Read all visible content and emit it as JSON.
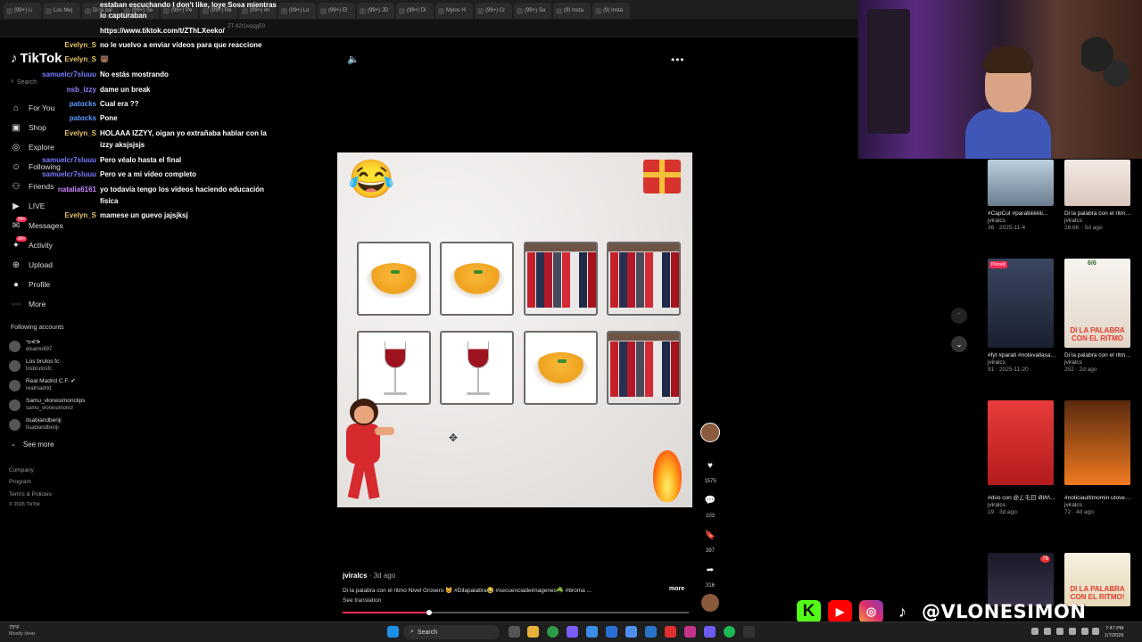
{
  "browser": {
    "tabs": [
      "(99+) Li",
      "Los Mej",
      "Di la pal",
      "(99+) Se",
      "(99+) Pe",
      "(99+) Re",
      "(99+) #n",
      "(99+) Lo",
      "(99+) El",
      "(99+) JD",
      "(99+) Di",
      "Mylos H",
      "(99+) Cr",
      "(99+) Sa",
      "(9) Insta",
      "(9) Insta"
    ],
    "url_fragment": "ZT-92t1wqqgE0"
  },
  "chat": [
    {
      "user": "",
      "user_color": "#ffffff",
      "message": "estaban escuchando I don't like, loye Sosa mientras"
    },
    {
      "user": "",
      "user_color": "#ffffff",
      "message": "lo capturaban"
    },
    {
      "user": "",
      "user_color": "#ffffff",
      "message": "https://www.tiktok.com/t/ZThLXeeko/"
    },
    {
      "user": "Evelyn_S",
      "user_color": "#e6c46a",
      "message": "no le vuelvo a enviar videos para que reaccione"
    },
    {
      "user": "Evelyn_S",
      "user_color": "#e6c46a",
      "message": "🐻"
    },
    {
      "user": "samuelcr7sluuu",
      "user_color": "#7a7cff",
      "message": "No estás mostrando"
    },
    {
      "user": "nsb_izzy",
      "user_color": "#9b7cff",
      "message": "dame un break"
    },
    {
      "user": "patocks",
      "user_color": "#5aa0ff",
      "message": "Cual era ??"
    },
    {
      "user": "patocks",
      "user_color": "#5aa0ff",
      "message": "Pone"
    },
    {
      "user": "Evelyn_S",
      "user_color": "#e6c46a",
      "message": "HOLAAA IZZYY, oigan yo extrañaba hablar con la"
    },
    {
      "user": "",
      "user_color": "#ffffff",
      "message": "izzy aksjsjsjs"
    },
    {
      "user": "samuelcr7sluuu",
      "user_color": "#7a7cff",
      "message": "Pero véalo hasta el final"
    },
    {
      "user": "samuelcr7sluuu",
      "user_color": "#7a7cff",
      "message": "Pero ve a mi video completo"
    },
    {
      "user": "natalia6161",
      "user_color": "#cc88ff",
      "message": "yo todavía tengo los videos haciendo educación"
    },
    {
      "user": "",
      "user_color": "#ffffff",
      "message": "física"
    },
    {
      "user": "Evelyn_S",
      "user_color": "#e6c46a",
      "message": "mamese un guevo jajsjksj"
    }
  ],
  "tiktok": {
    "logo": "TikTok",
    "search_label": "Search",
    "nav": [
      {
        "label": "For You",
        "icon": "home-icon"
      },
      {
        "label": "Shop",
        "icon": "shop-icon"
      },
      {
        "label": "Explore",
        "icon": "compass-icon"
      },
      {
        "label": "Following",
        "icon": "following-icon"
      },
      {
        "label": "Friends",
        "icon": "friends-icon"
      },
      {
        "label": "LIVE",
        "icon": "live-icon"
      },
      {
        "label": "Messages",
        "icon": "messages-icon",
        "badge": "99+"
      },
      {
        "label": "Activity",
        "icon": "activity-icon",
        "badge": "99+"
      },
      {
        "label": "Upload",
        "icon": "upload-icon"
      },
      {
        "label": "Profile",
        "icon": "profile-icon"
      },
      {
        "label": "More",
        "icon": "more-icon"
      }
    ],
    "following_title": "Following accounts",
    "accounts": [
      {
        "name": "ఌ⋞⋟",
        "handle": "elsamu697"
      },
      {
        "name": "Los brutos fc",
        "handle": "losbrutosfc"
      },
      {
        "name": "Real Madrid C.F. ✔",
        "handle": "realmadrid"
      },
      {
        "name": "Samu_vlonesimonclips",
        "handle": "samu_vlonesimoncl"
      },
      {
        "name": "itsabiandbenji",
        "handle": "itsabiandbenji"
      }
    ],
    "see_more": "See more",
    "footer": [
      "Company",
      "Program",
      "Terms & Policies",
      "© 2026 TikTok"
    ]
  },
  "video": {
    "author": "jviralcs",
    "date": "· 3d ago",
    "caption": "Di la palabra con el ritmo Nivel Grosero 😺 #Dilapalabra😂 #secuenciadeimagenes☘️ #broma ...",
    "caption_more": "more",
    "see_translation": "See translation",
    "progress": 0.25,
    "grid": [
      "soup",
      "soup",
      "clothes",
      "clothes",
      "wine",
      "wine",
      "soup",
      "clothes"
    ],
    "likes": "1575",
    "comments": "103",
    "saves": "397",
    "shares": "316"
  },
  "feed": [
    {
      "title": "#CapCut #paratiiiiiiiiiii...",
      "author": "jviralcs",
      "stats": "36 · 2025-11-4"
    },
    {
      "title": "Di la palabra con el ritmo 😂 ...",
      "author": "jviralcs",
      "stats": "28.6K · 5d ago"
    },
    {
      "title": "#fyt #parati #notevallasaena...",
      "author": "jviralcs",
      "stats": "91 · 2025-11-20",
      "pinned": "Pinned"
    },
    {
      "title": "Di la palabra con el ritmo nivel...",
      "author": "jviralcs",
      "stats": "252 · 2d ago"
    },
    {
      "title": "#dúo con @ㄥ乇ㄖ ØИΛ R Ðo 🙇 ...",
      "author": "jviralcs",
      "stats": "19 · 3d ago"
    },
    {
      "title": "#noticiaultimomin utovenezuela...",
      "author": "jviralcs",
      "stats": "72 · 4d ago"
    },
    {
      "title": "",
      "author": "",
      "stats": ""
    },
    {
      "title": "",
      "author": "",
      "stats": ""
    }
  ],
  "thumb_text": {
    "t4": "DI LA PALABRA CON EL RITMO",
    "t4_top": "6/6",
    "t8": "DI LA PALABRA CON EL RITMO!",
    "t7_badge": "76"
  },
  "overlay": {
    "handle": "@VLONESIMON"
  },
  "taskbar": {
    "weather_temp": "73°F",
    "weather_desc": "Mostly clear",
    "search": "Search",
    "time": "7:47 PM",
    "date": "1/7/2026"
  }
}
